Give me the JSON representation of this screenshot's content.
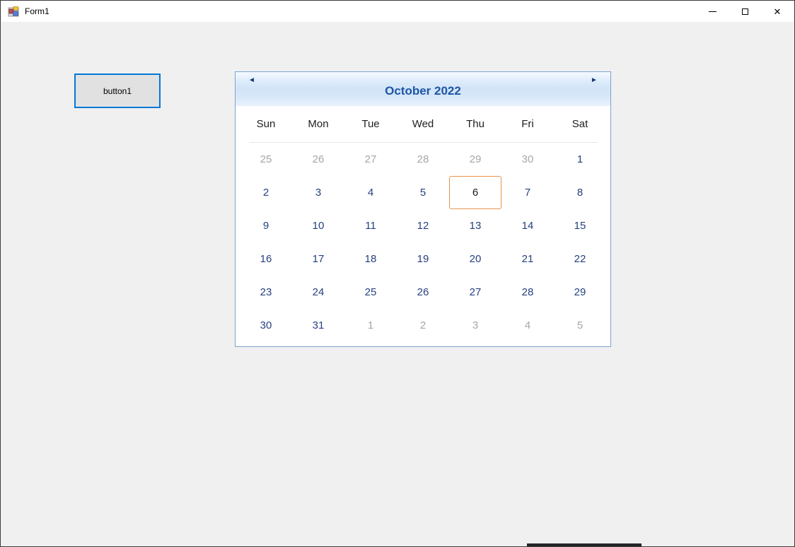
{
  "window": {
    "title": "Form1",
    "controls": {
      "minimize": "minimize",
      "maximize": "maximize",
      "close": "✕"
    }
  },
  "button1": {
    "label": "button1"
  },
  "calendar": {
    "header": {
      "title": "October 2022",
      "prev_arrow": "◄",
      "next_arrow": "►"
    },
    "day_names": [
      "Sun",
      "Mon",
      "Tue",
      "Wed",
      "Thu",
      "Fri",
      "Sat"
    ],
    "today_date": "6",
    "cells": [
      {
        "label": "25",
        "variant": "muted"
      },
      {
        "label": "26",
        "variant": "muted"
      },
      {
        "label": "27",
        "variant": "muted"
      },
      {
        "label": "28",
        "variant": "muted"
      },
      {
        "label": "29",
        "variant": "muted"
      },
      {
        "label": "30",
        "variant": "muted"
      },
      {
        "label": "1",
        "variant": "normal"
      },
      {
        "label": "2",
        "variant": "normal"
      },
      {
        "label": "3",
        "variant": "normal"
      },
      {
        "label": "4",
        "variant": "normal"
      },
      {
        "label": "5",
        "variant": "normal"
      },
      {
        "label": "6",
        "variant": "today"
      },
      {
        "label": "7",
        "variant": "normal"
      },
      {
        "label": "8",
        "variant": "normal"
      },
      {
        "label": "9",
        "variant": "normal"
      },
      {
        "label": "10",
        "variant": "normal"
      },
      {
        "label": "11",
        "variant": "normal"
      },
      {
        "label": "12",
        "variant": "normal"
      },
      {
        "label": "13",
        "variant": "normal"
      },
      {
        "label": "14",
        "variant": "normal"
      },
      {
        "label": "15",
        "variant": "normal"
      },
      {
        "label": "16",
        "variant": "normal"
      },
      {
        "label": "17",
        "variant": "normal"
      },
      {
        "label": "18",
        "variant": "normal"
      },
      {
        "label": "19",
        "variant": "normal"
      },
      {
        "label": "20",
        "variant": "normal"
      },
      {
        "label": "21",
        "variant": "normal"
      },
      {
        "label": "22",
        "variant": "normal"
      },
      {
        "label": "23",
        "variant": "normal"
      },
      {
        "label": "24",
        "variant": "normal"
      },
      {
        "label": "25",
        "variant": "normal"
      },
      {
        "label": "26",
        "variant": "normal"
      },
      {
        "label": "27",
        "variant": "normal"
      },
      {
        "label": "28",
        "variant": "normal"
      },
      {
        "label": "29",
        "variant": "normal"
      },
      {
        "label": "30",
        "variant": "normal"
      },
      {
        "label": "31",
        "variant": "normal"
      },
      {
        "label": "1",
        "variant": "muted"
      },
      {
        "label": "2",
        "variant": "muted"
      },
      {
        "label": "3",
        "variant": "muted"
      },
      {
        "label": "4",
        "variant": "muted"
      },
      {
        "label": "5",
        "variant": "muted"
      }
    ]
  },
  "colors": {
    "accent": "#0078d7",
    "headertext": "#1d56a5",
    "datecolor": "#26417f",
    "mutedcolor": "#a6a6a6",
    "todayborder": "#e8944d",
    "calborder": "#7ba3d0"
  }
}
